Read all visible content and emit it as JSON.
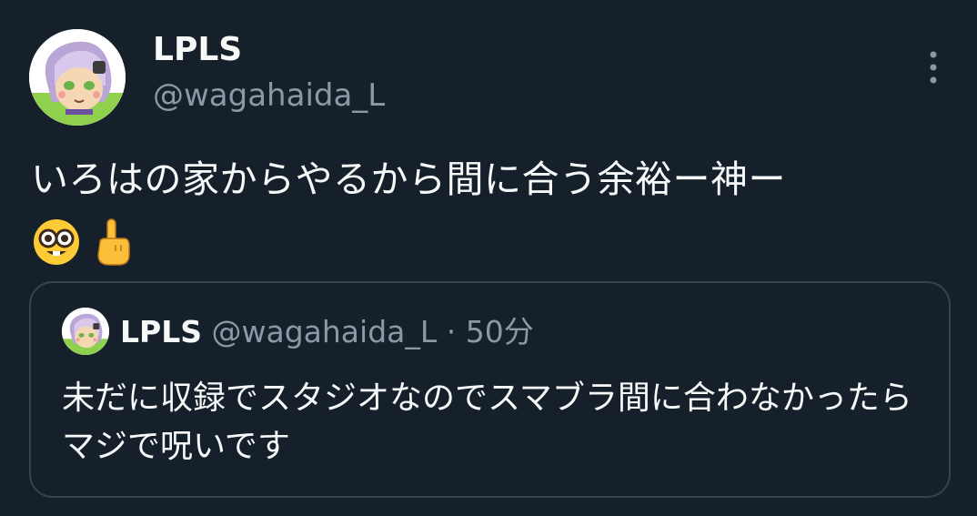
{
  "tweet": {
    "author": {
      "display_name": "LPLS",
      "handle": "@wagahaida_L",
      "avatar_icon": "avatar-image"
    },
    "more_icon": "more-options-icon",
    "text": "いろはの家からやるから間に合う余裕ー神ー",
    "emojis": [
      "nerd-face-emoji",
      "index-pointing-up-emoji"
    ]
  },
  "quote": {
    "display_name": "LPLS",
    "handle": "@wagahaida_L",
    "separator": "·",
    "time": "50分",
    "text": "未だに収録でスタジオなのでスマブラ間に合わなかったらマジで呪いです"
  },
  "colors": {
    "background": "#15202b",
    "primary_text": "#f7f9f9",
    "secondary_text": "#8b98a5",
    "border": "#38444d"
  }
}
